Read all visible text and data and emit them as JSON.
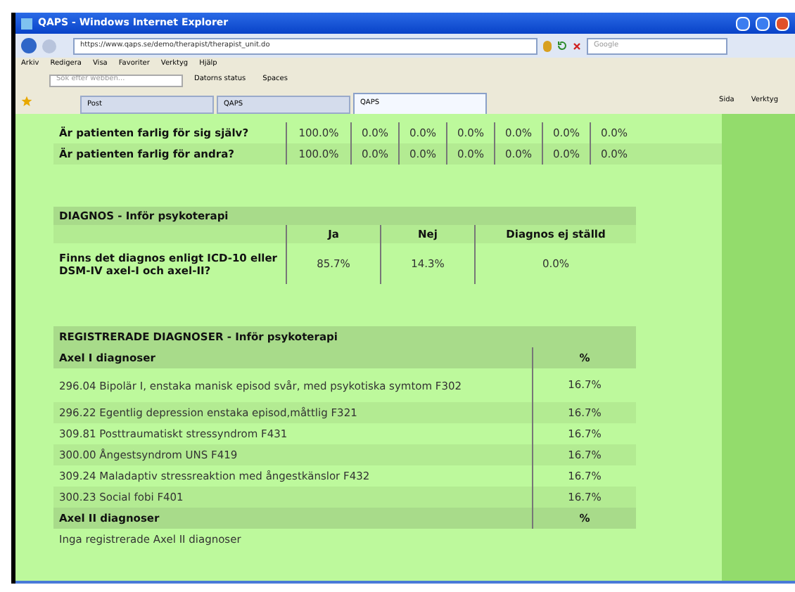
{
  "window": {
    "title": "QAPS - Windows Internet Explorer"
  },
  "address_bar": {
    "url": "https://www.qaps.se/demo/therapist/therapist_unit.do",
    "search_placeholder": "Google"
  },
  "menu": [
    "Arkiv",
    "Redigera",
    "Visa",
    "Favoriter",
    "Verktyg",
    "Hjälp"
  ],
  "toolbar": {
    "search_placeholder": "Sök efter webben...",
    "items": [
      "Datorns status",
      "Spaces"
    ]
  },
  "tabs": [
    {
      "label": "Post",
      "selected": false
    },
    {
      "label": "QAPS",
      "selected": false
    },
    {
      "label": "QAPS",
      "selected": true
    }
  ],
  "command_bar": [
    "Sida",
    "Verktyg"
  ],
  "danger_table": {
    "rows": [
      {
        "question": "Är patienten farlig för sig själv?",
        "values": [
          "100.0%",
          "0.0%",
          "0.0%",
          "0.0%",
          "0.0%",
          "0.0%",
          "0.0%"
        ]
      },
      {
        "question": "Är patienten farlig för andra?",
        "values": [
          "100.0%",
          "0.0%",
          "0.0%",
          "0.0%",
          "0.0%",
          "0.0%",
          "0.0%"
        ]
      }
    ]
  },
  "diagnosis_table": {
    "title": "DIAGNOS - Inför psykoterapi",
    "columns": [
      "Ja",
      "Nej",
      "Diagnos ej ställd"
    ],
    "rows": [
      {
        "question": "Finns det diagnos enligt ICD-10 eller DSM-IV axel-I och axel-II?",
        "values": [
          "85.7%",
          "14.3%",
          "0.0%"
        ]
      }
    ]
  },
  "registered_table": {
    "title": "REGISTRERADE DIAGNOSER - Inför psykoterapi",
    "groups": [
      {
        "heading": "Axel I diagnoser",
        "percent_heading": "%",
        "rows": [
          {
            "diagnosis": "296.04 Bipolär I, enstaka manisk episod svår, med psykotiska symtom F302",
            "percent": "16.7%"
          },
          {
            "diagnosis": "296.22 Egentlig depression enstaka episod,måttlig F321",
            "percent": "16.7%"
          },
          {
            "diagnosis": "309.81 Posttraumatiskt stressyndrom F431",
            "percent": "16.7%"
          },
          {
            "diagnosis": "300.00 Ångestsyndrom UNS F419",
            "percent": "16.7%"
          },
          {
            "diagnosis": "309.24 Maladaptiv stressreaktion med ångestkänslor F432",
            "percent": "16.7%"
          },
          {
            "diagnosis": "300.23 Social fobi F401",
            "percent": "16.7%"
          }
        ]
      },
      {
        "heading": "Axel II diagnoser",
        "percent_heading": "%",
        "empty_text": "Inga registrerade Axel II diagnoser"
      }
    ]
  }
}
